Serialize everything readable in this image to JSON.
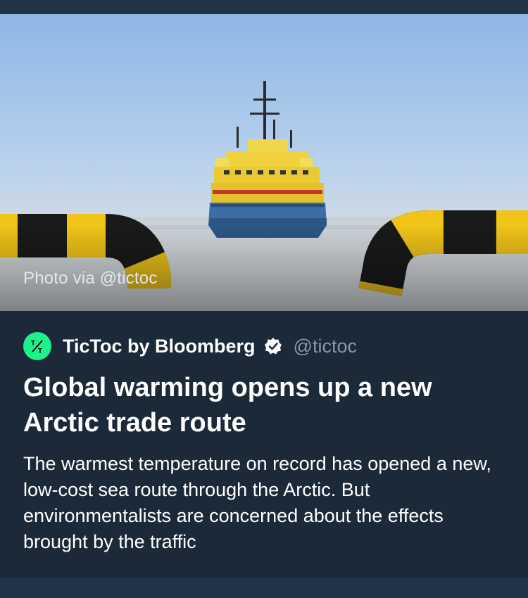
{
  "card": {
    "photo_credit": "Photo via @tictoc",
    "source": {
      "name": "TicToc by Bloomberg",
      "handle": "@tictoc",
      "verified": true,
      "avatar_icon": "tictoc-logo-icon",
      "avatar_color": "#1ef08c"
    },
    "headline": "Global warming opens up a new Arctic trade route",
    "summary": "The warmest temperature on record has opened a new, low-cost sea route through the Arctic. But environmentalists are concerned about the effects brought by the traffic"
  },
  "colors": {
    "card_background": "#1c2938",
    "page_background": "#243447",
    "handle_text": "#8899a6",
    "primary_text": "#ffffff"
  }
}
